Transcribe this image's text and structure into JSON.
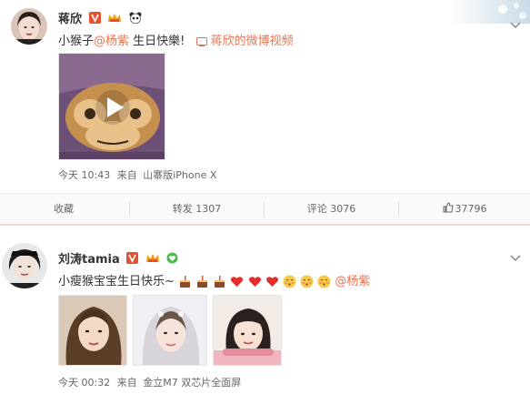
{
  "posts": [
    {
      "username": "蒋欣",
      "content_prefix": "小猴子",
      "mention": "@杨紫",
      "content_suffix": " 生日快樂!",
      "video_link": "蒋欣的微博视频",
      "time": "今天 10:43",
      "source_prefix": "来自",
      "source": "山寨版iPhone X",
      "actions": {
        "collect": "收藏",
        "repost": "转发 1307",
        "comment": "评论 3076",
        "like": "37796"
      }
    },
    {
      "username": "刘涛tamia",
      "content_prefix": "小瘦猴宝宝生日快乐~",
      "mention": "@杨紫",
      "time": "今天 00:32",
      "source_prefix": "来自",
      "source": "金立M7 双芯片全面屏"
    }
  ],
  "colors": {
    "link": "#eb7350",
    "verified": "#e5512d",
    "crown": "#f3a01c"
  },
  "icons": [
    "verified-icon",
    "crown-vip-icon",
    "panda-icon",
    "play-icon",
    "video-link-icon",
    "chevron-down-icon",
    "thumbs-up-icon",
    "cake-emoji",
    "heart-emoji",
    "shy-face-emoji"
  ]
}
